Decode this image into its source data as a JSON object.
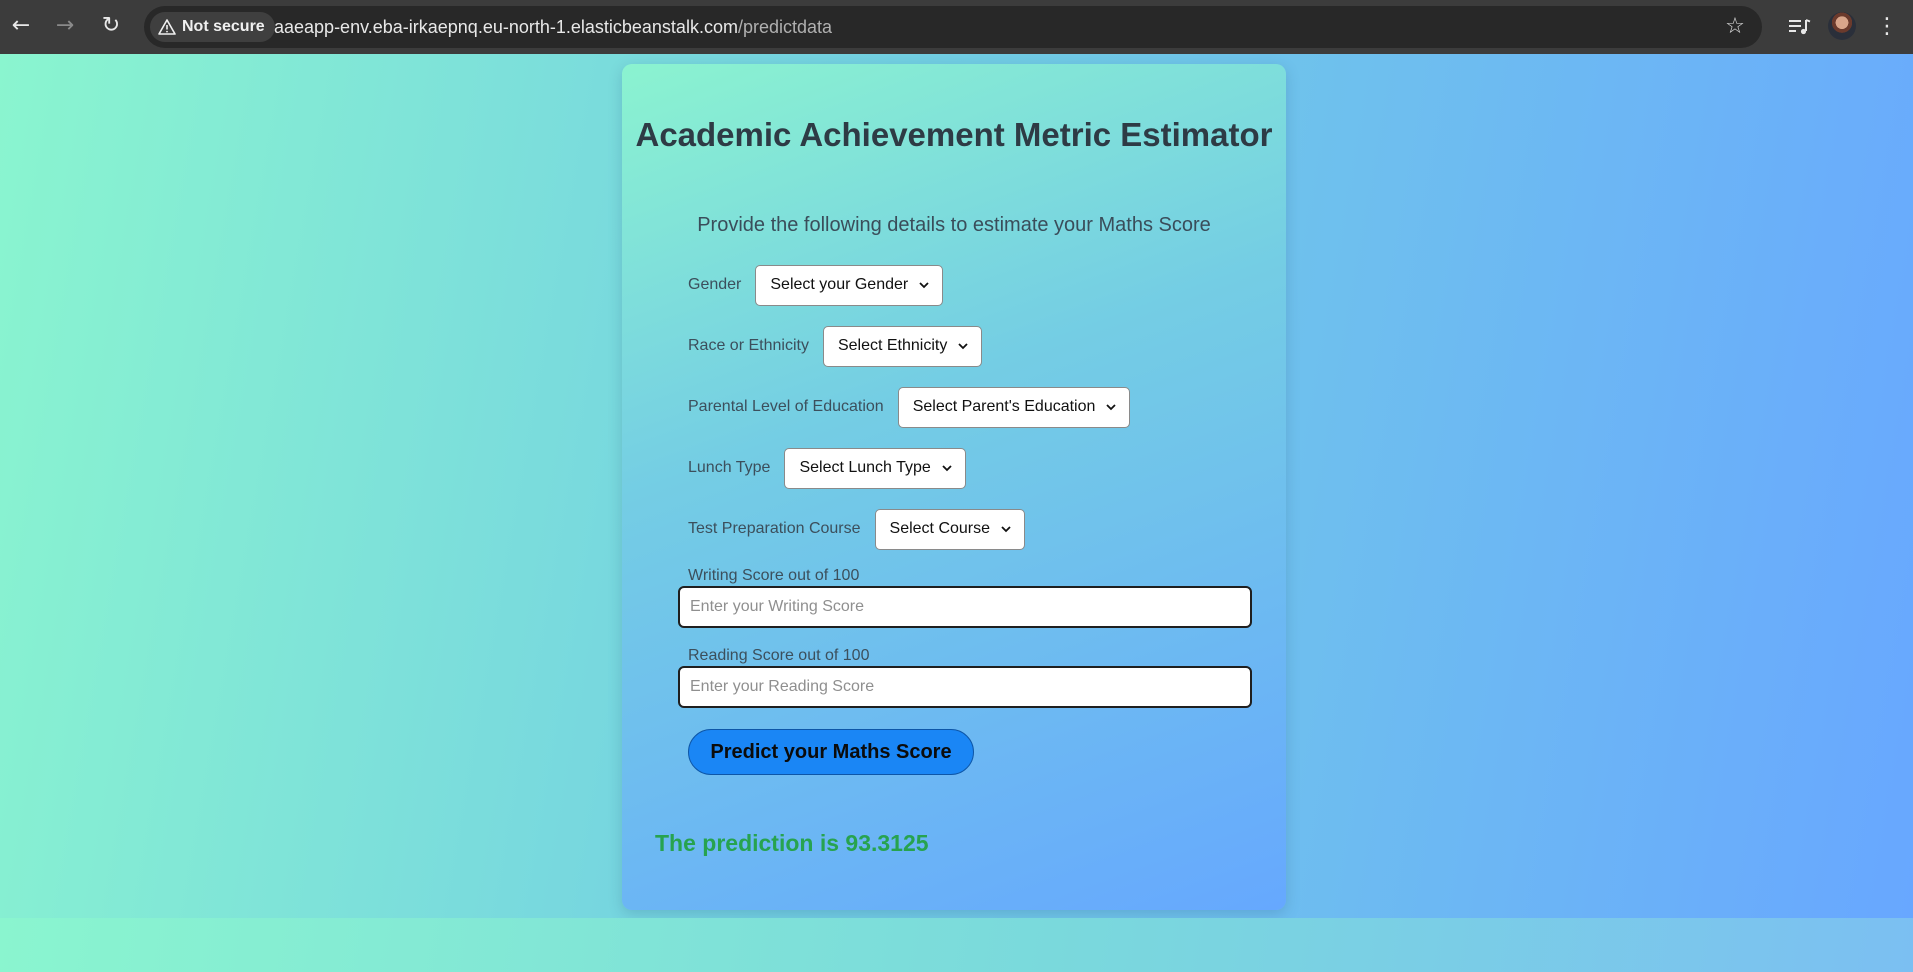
{
  "browser": {
    "security_label": "Not secure",
    "url_host": "aaeapp-env.eba-irkaepnq.eu-north-1.elasticbeanstalk.com",
    "url_path": "/predictdata",
    "icons": [
      "back-icon",
      "forward-icon",
      "reload-icon",
      "warning-icon",
      "star-icon",
      "media-icon",
      "profile-avatar",
      "menu-icon"
    ]
  },
  "page": {
    "title": "Academic Achievement Metric Estimator",
    "subtitle": "Provide the following details to estimate your Maths Score",
    "fields": {
      "gender": {
        "label": "Gender",
        "selected": "Select your Gender"
      },
      "ethnicity": {
        "label": "Race or Ethnicity",
        "selected": "Select Ethnicity"
      },
      "parent_education": {
        "label": "Parental Level of Education",
        "selected": "Select Parent's Education"
      },
      "lunch": {
        "label": "Lunch Type",
        "selected": "Select Lunch Type"
      },
      "test_prep": {
        "label": "Test Preparation Course",
        "selected": "Select Course"
      }
    },
    "writing": {
      "label": "Writing Score out of 100",
      "placeholder": "Enter your Writing Score",
      "value": ""
    },
    "reading": {
      "label": "Reading Score out of 100",
      "placeholder": "Enter your Reading Score",
      "value": ""
    },
    "submit_label": "Predict your Maths Score",
    "result_text": "The prediction is 93.3125"
  },
  "colors": {
    "background_start": "#8af5cf",
    "background_end": "#68a7ff",
    "button": "#1a86f5",
    "result": "#27a34f",
    "title": "#2e3b45"
  }
}
